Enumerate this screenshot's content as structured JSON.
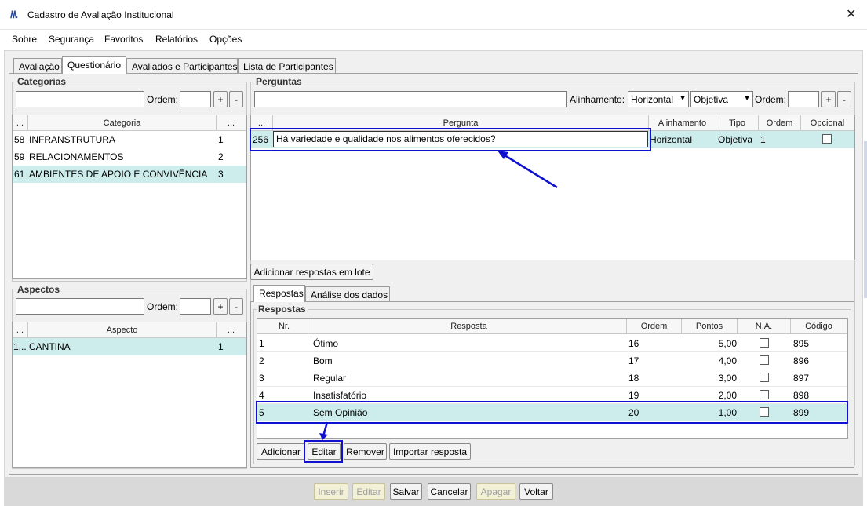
{
  "window": {
    "title": "Cadastro de Avaliação Institucional",
    "app_icon": "/\\/\\."
  },
  "menu": [
    {
      "label": "Sobre"
    },
    {
      "label": "Segurança"
    },
    {
      "label": "Favoritos"
    },
    {
      "label": "Relatórios"
    },
    {
      "label": "Opções"
    }
  ],
  "tabs": [
    "Avaliação",
    "Questionário",
    "Avaliados e Participantes",
    "Lista de Participantes"
  ],
  "categorias": {
    "title": "Categorias",
    "ordem_label": "Ordem:",
    "plus": "+",
    "minus": "-",
    "headers": [
      "...",
      "Categoria",
      "..."
    ],
    "rows": [
      {
        "id": "58",
        "name": "INFRANSTRUTURA",
        "ord": "1"
      },
      {
        "id": "59",
        "name": "RELACIONAMENTOS",
        "ord": "2"
      },
      {
        "id": "61",
        "name": "AMBIENTES DE APOIO E CONVIVÊNCIA",
        "ord": "3"
      }
    ]
  },
  "aspectos": {
    "title": "Aspectos",
    "ordem_label": "Ordem:",
    "plus": "+",
    "minus": "-",
    "headers": [
      "...",
      "Aspecto",
      "..."
    ],
    "rows": [
      {
        "id": "1...",
        "name": "CANTINA",
        "ord": "1"
      }
    ]
  },
  "perguntas": {
    "title": "Perguntas",
    "alinhamento_label": "Alinhamento:",
    "alinhamento_value": "Horizontal",
    "tipo_value": "Objetiva",
    "ordem_label": "Ordem:",
    "plus": "+",
    "minus": "-",
    "headers": [
      "...",
      "Pergunta",
      "Alinhamento",
      "Tipo",
      "Ordem",
      "Opcional"
    ],
    "row": {
      "id": "256",
      "text": "Há variedade e qualidade nos alimentos oferecidos?",
      "alinhamento": "Horizontal",
      "tipo": "Objetiva",
      "ordem": "1"
    },
    "lote_button": "Adicionar respostas em lote"
  },
  "subtabs": [
    "Respostas",
    "Análise dos dados"
  ],
  "respostas": {
    "title": "Respostas",
    "headers": [
      "Nr.",
      "Resposta",
      "Ordem",
      "Pontos",
      "N.A.",
      "Código"
    ],
    "rows": [
      {
        "nr": "1",
        "resposta": "Ótimo",
        "ordem": "16",
        "pontos": "5,00",
        "codigo": "895"
      },
      {
        "nr": "2",
        "resposta": "Bom",
        "ordem": "17",
        "pontos": "4,00",
        "codigo": "896"
      },
      {
        "nr": "3",
        "resposta": "Regular",
        "ordem": "18",
        "pontos": "3,00",
        "codigo": "897"
      },
      {
        "nr": "4",
        "resposta": "Insatisfatório",
        "ordem": "19",
        "pontos": "2,00",
        "codigo": "898"
      },
      {
        "nr": "5",
        "resposta": "Sem Opinião",
        "ordem": "20",
        "pontos": "1,00",
        "codigo": "899"
      }
    ],
    "buttons": [
      "Adicionar",
      "Editar",
      "Remover",
      "Importar resposta"
    ]
  },
  "bottom_buttons": [
    "Inserir",
    "Editar",
    "Salvar",
    "Cancelar",
    "Apagar",
    "Voltar"
  ],
  "colors": {
    "highlight": "#1010d0",
    "selected_row": "#cdecec"
  }
}
